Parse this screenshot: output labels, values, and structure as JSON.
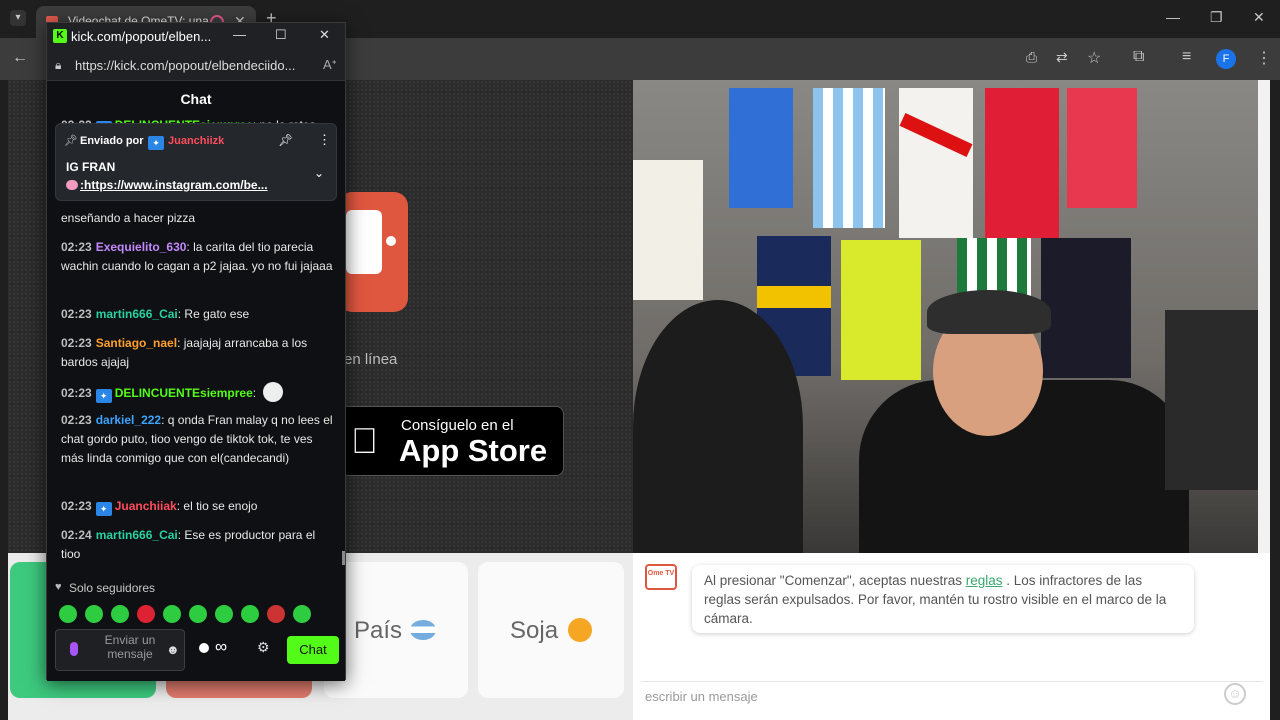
{
  "browser": {
    "tab_title": "Videochat de OmeTV: una",
    "new_tab": "+",
    "profile_initial": "F"
  },
  "popout": {
    "title": "kick.com/popout/elben...",
    "url": "https://kick.com/popout/elbendeciido...",
    "chat_header": "Chat",
    "pinned": {
      "sent_by": "Enviado por",
      "user": "Juanchiizk",
      "title": "IG FRAN",
      "link": ":https://www.instagram.com/be..."
    },
    "messages": [
      {
        "time": "02:22",
        "user": "DELINCUENTEsiempree",
        "text": ": no lo retes",
        "color": "u-green",
        "badge": true
      },
      {
        "time": "",
        "user": "",
        "text": "enseñando a hacer pizza",
        "color": "",
        "badge": false
      },
      {
        "time": "02:23",
        "user": "Exequielito_630",
        "text": ": la carita del tio parecia wachin cuando lo cagan a p2 jajaa. yo no fui jajaaa",
        "color": "u-purple",
        "badge": false
      },
      {
        "time": "02:23",
        "user": "martin666_Cai",
        "text": ": Re gato ese",
        "color": "u-teal",
        "badge": false
      },
      {
        "time": "02:23",
        "user": "Santiago_nael",
        "text": ": jaajajaj arrancaba a los bardos ajajaj",
        "color": "u-orange",
        "badge": false
      },
      {
        "time": "02:23",
        "user": "DELINCUENTEsiempree",
        "text": ":",
        "color": "u-green",
        "badge": true
      },
      {
        "time": "02:23",
        "user": "darkiel_222",
        "text": ": q onda Fran malay q no lees el chat gordo puto, tioo vengo de tiktok tok, te ves más linda conmigo que con el(candecandi)",
        "color": "u-blue",
        "badge": false
      },
      {
        "time": "02:23",
        "user": "Juanchiiak",
        "text": ": el tio se enojo",
        "color": "u-red",
        "badge": true
      },
      {
        "time": "02:24",
        "user": "martin666_Cai",
        "text": ": Ese es productor para el tioo",
        "color": "u-teal",
        "badge": false
      }
    ],
    "followers_only": "Solo seguidores",
    "input_placeholder": "Enviar un mensaje",
    "infinity": "∞",
    "chat_button": "Chat"
  },
  "ome": {
    "online_text": "en línea",
    "appstore_small": "Consíguelo en el",
    "appstore_big": "App Store",
    "tile_country": "País",
    "tile_gender": "Soja",
    "rules_pre": "Al presionar \"Comenzar\", aceptas nuestras ",
    "rules_link": "reglas",
    "rules_post": " . Los infractores de las reglas serán expulsados. Por favor, mantén tu rostro visible en el marco de la cámara.",
    "logo_text": "Ome TV",
    "message_placeholder": "escribir un mensaje"
  }
}
